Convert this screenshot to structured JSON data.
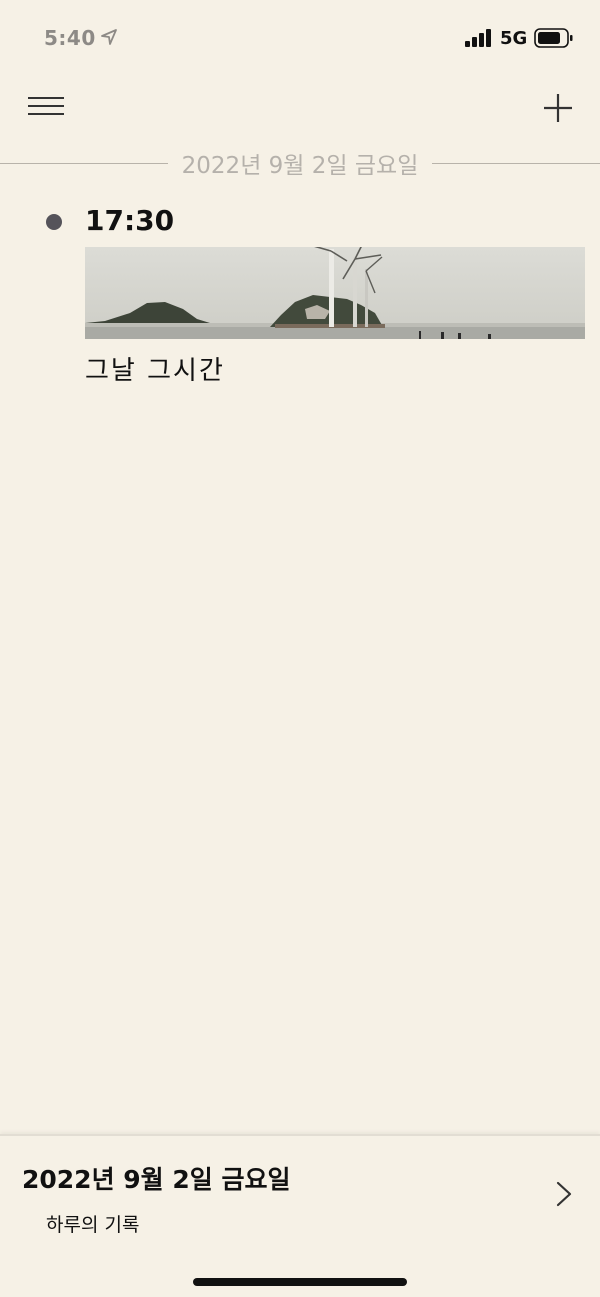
{
  "status_bar": {
    "time": "5:40",
    "network": "5G",
    "icons": [
      "location-arrow-icon",
      "signal-bars-icon",
      "battery-icon"
    ]
  },
  "toolbar": {
    "menu_icon": "hamburger-menu-icon",
    "add_icon": "plus-icon"
  },
  "timeline": {
    "date_header": "2022년 9월 2일 금요일",
    "entries": [
      {
        "time": "17:30",
        "image": "seaside-wind-turbines-photo",
        "text": "그날 그시간"
      }
    ]
  },
  "bottom_panel": {
    "date": "2022년 9월 2일 금요일",
    "subtitle": "하루의 기록",
    "chevron_icon": "chevron-right-icon"
  },
  "colors": {
    "background": "#f6f1e6",
    "dot": "#55535a",
    "muted_text": "#b5b1ab",
    "text": "#111111"
  }
}
